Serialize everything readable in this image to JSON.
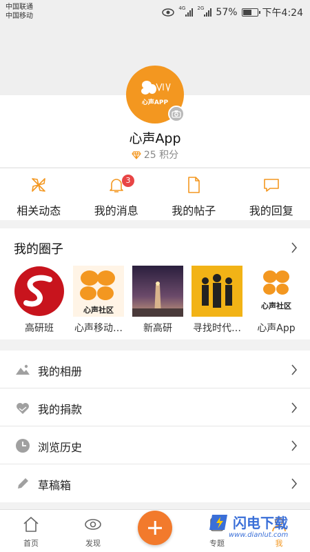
{
  "status_bar": {
    "carrier_1": "中国联通",
    "carrier_2": "中国移动",
    "signal_1_type": "4G",
    "signal_2_type": "2G",
    "battery": "57%",
    "time": "下午4:24"
  },
  "profile": {
    "avatar_text": "心声APP",
    "username": "心声App",
    "points": "25 积分"
  },
  "quick_actions": [
    {
      "label": "相关动态",
      "icon": "pinwheel-icon"
    },
    {
      "label": "我的消息",
      "icon": "bell-icon",
      "badge": "3"
    },
    {
      "label": "我的帖子",
      "icon": "document-icon"
    },
    {
      "label": "我的回复",
      "icon": "chat-bubble-icon"
    }
  ],
  "circles": {
    "title": "我的圈子",
    "items": [
      {
        "name": "高研班"
      },
      {
        "name": "心声移动…",
        "thumb_text": "心声社区"
      },
      {
        "name": "新高研"
      },
      {
        "name": "寻找时代…"
      },
      {
        "name": "心声App",
        "thumb_text": "心声社区"
      }
    ]
  },
  "menu": [
    {
      "label": "我的相册",
      "icon": "album-icon"
    },
    {
      "label": "我的捐款",
      "icon": "heart-hands-icon"
    },
    {
      "label": "浏览历史",
      "icon": "clock-icon"
    },
    {
      "label": "草稿箱",
      "icon": "pencil-icon"
    }
  ],
  "tabs": [
    {
      "label": "首页",
      "icon": "home-icon"
    },
    {
      "label": "发现",
      "icon": "eye-icon"
    },
    {
      "label": "专题",
      "icon": "topic-icon"
    },
    {
      "label": "我",
      "icon": "me-icon",
      "active": true
    }
  ],
  "watermark": {
    "text": "闪电下载",
    "url": "www.dianlut.com"
  },
  "colors": {
    "accent": "#f39720",
    "fab": "#f27a2c",
    "badge": "#e84545",
    "icon_gray": "#9a9a9a"
  }
}
